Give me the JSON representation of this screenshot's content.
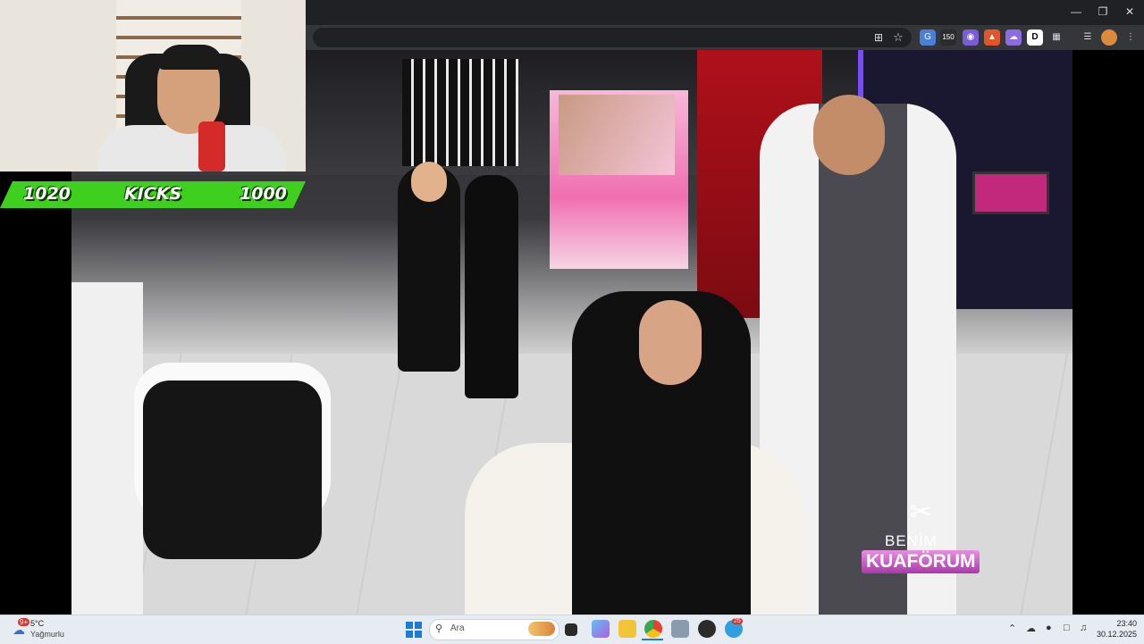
{
  "overlay": {
    "left_count": "1020",
    "label": "KICKS",
    "right_count": "1000",
    "accent": "#3fcf1e"
  },
  "video": {
    "logo_line1": "BENİM",
    "logo_line2": "KUAFÖRUM"
  },
  "browser": {
    "minimize_icon": "minimize-icon",
    "maximize_icon": "restore-icon",
    "close_icon": "close-icon",
    "badge_count": "150"
  },
  "taskbar": {
    "weather_temp": "5°C",
    "weather_desc": "Yağmurlu",
    "weather_badge": "9+",
    "search_placeholder": "Ara",
    "time": "23:40",
    "date": "30.12.2025",
    "notif_badge": "25"
  }
}
